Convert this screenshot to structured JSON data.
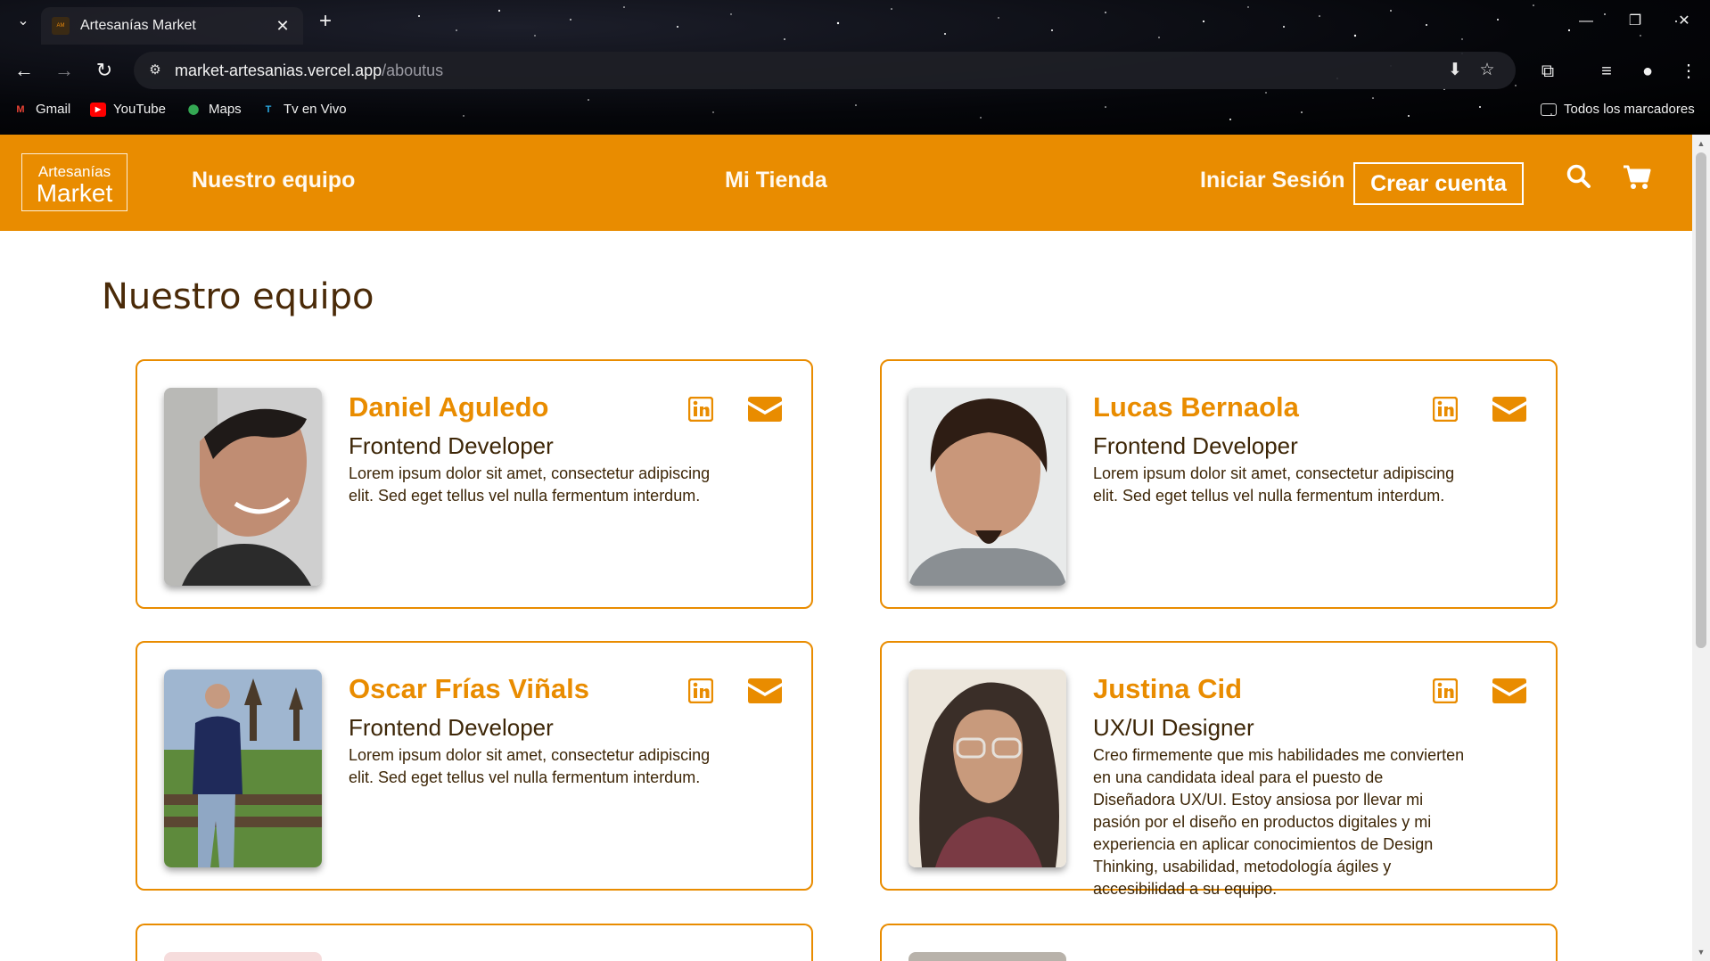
{
  "browser": {
    "tab_title": "Artesanías Market",
    "url_host": "market-artesanias.vercel.app",
    "url_path": "/aboutus",
    "bookmarks": [
      {
        "label": "Gmail"
      },
      {
        "label": "YouTube"
      },
      {
        "label": "Maps"
      },
      {
        "label": "Tv en Vivo"
      }
    ],
    "all_bookmarks_label": "Todos los marcadores"
  },
  "header": {
    "logo_line1": "Artesanías",
    "logo_line2": "Market",
    "nav_team": "Nuestro equipo",
    "nav_store": "Mi Tienda",
    "login": "Iniciar Sesión",
    "create_account": "Crear cuenta",
    "accent_color": "#e98c00"
  },
  "page": {
    "title": "Nuestro equipo"
  },
  "team": [
    {
      "name": "Daniel Aguledo",
      "role": "Frontend Developer",
      "description": "Lorem ipsum dolor sit amet, consectetur adipiscing elit. Sed eget tellus vel nulla fermentum interdum."
    },
    {
      "name": "Lucas Bernaola",
      "role": "Frontend Developer",
      "description": "Lorem ipsum dolor sit amet, consectetur adipiscing elit. Sed eget tellus vel nulla fermentum interdum."
    },
    {
      "name": "Oscar Frías Viñals",
      "role": "Frontend Developer",
      "description": "Lorem ipsum dolor sit amet, consectetur adipiscing elit. Sed eget tellus vel nulla fermentum interdum."
    },
    {
      "name": "Justina Cid",
      "role": "UX/UI Designer",
      "description": "Creo firmemente que mis habilidades me convierten en una candidata ideal para el puesto de Diseñadora UX/UI. Estoy ansiosa por llevar mi pasión por el diseño en productos digitales y mi experiencia en aplicar conocimientos de Design Thinking, usabilidad, metodología ágiles y accesibilidad a su equipo."
    }
  ]
}
